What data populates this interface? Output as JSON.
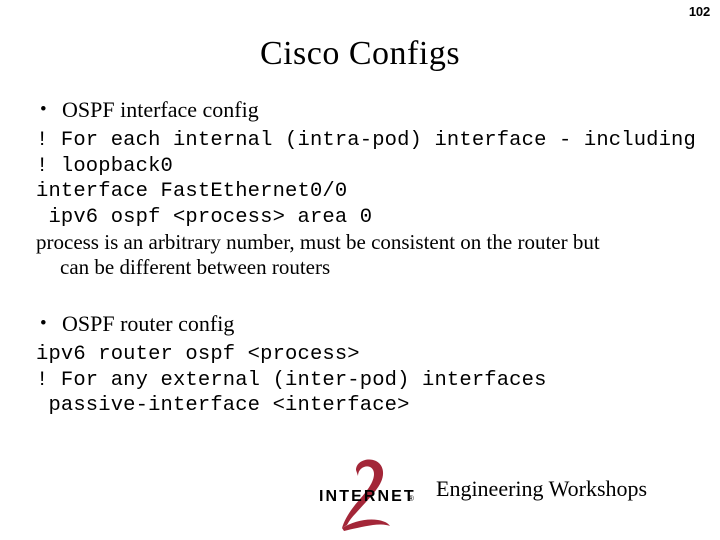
{
  "slide": {
    "page_number": "102",
    "title": "Cisco Configs",
    "background_color": "#ffffff",
    "text_color": "#000000"
  },
  "sections": [
    {
      "bullet_mark": "•",
      "heading": "OSPF interface config",
      "code_lines": [
        "! For each internal (intra-pod) interface - including",
        "! loopback0",
        "interface FastEthernet0/0",
        " ipv6 ospf <process> area 0"
      ],
      "note": "process is an arbitrary number, must be consistent on the router but",
      "note_continuation": "can be different between routers"
    },
    {
      "bullet_mark": "•",
      "heading": "OSPF router config",
      "code_lines": [
        "ipv6 router ospf <process>",
        "! For any external (inter-pod) interfaces",
        " passive-interface <interface>"
      ]
    }
  ],
  "footer": {
    "logo_wordmark": "INTERNET",
    "logo_numeral": "2",
    "logo_registered_mark": "®",
    "logo_red": "#A32638",
    "logo_black": "#000000",
    "text": "Engineering Workshops"
  }
}
